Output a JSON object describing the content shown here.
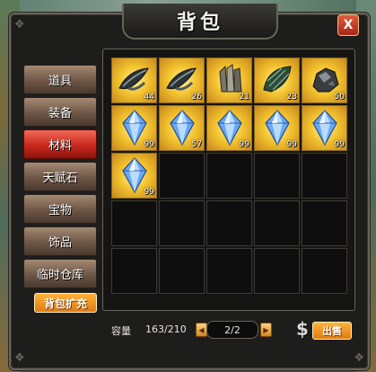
{
  "window": {
    "title": "背包",
    "close_label": "X"
  },
  "sidebar": {
    "tabs": [
      {
        "label": "道具",
        "active": false
      },
      {
        "label": "装备",
        "active": false
      },
      {
        "label": "材料",
        "active": true
      },
      {
        "label": "天赋石",
        "active": false
      },
      {
        "label": "宝物",
        "active": false
      },
      {
        "label": "饰品",
        "active": false
      },
      {
        "label": "临时仓库",
        "active": false
      }
    ],
    "expand_label": "背包扩充"
  },
  "inventory": {
    "slots": [
      {
        "icon": "dark-feather-icon",
        "count": "44"
      },
      {
        "icon": "dark-feather-icon",
        "count": "26"
      },
      {
        "icon": "stone-pillar-icon",
        "count": "21"
      },
      {
        "icon": "green-scale-icon",
        "count": "23"
      },
      {
        "icon": "iron-ore-icon",
        "count": "50"
      },
      {
        "icon": "blue-crystal-icon",
        "count": "99"
      },
      {
        "icon": "blue-crystal-icon",
        "count": "57"
      },
      {
        "icon": "blue-crystal-icon",
        "count": "99"
      },
      {
        "icon": "blue-crystal-icon",
        "count": "99"
      },
      {
        "icon": "blue-crystal-icon",
        "count": "99"
      },
      {
        "icon": "blue-crystal-icon",
        "count": "99"
      },
      null,
      null,
      null,
      null,
      null,
      null,
      null,
      null,
      null,
      null,
      null,
      null,
      null,
      null
    ]
  },
  "footer": {
    "capacity_label": "容量",
    "capacity_value": "163/210",
    "page": "2/2",
    "sell_label": "出售",
    "currency_symbol": "$"
  }
}
